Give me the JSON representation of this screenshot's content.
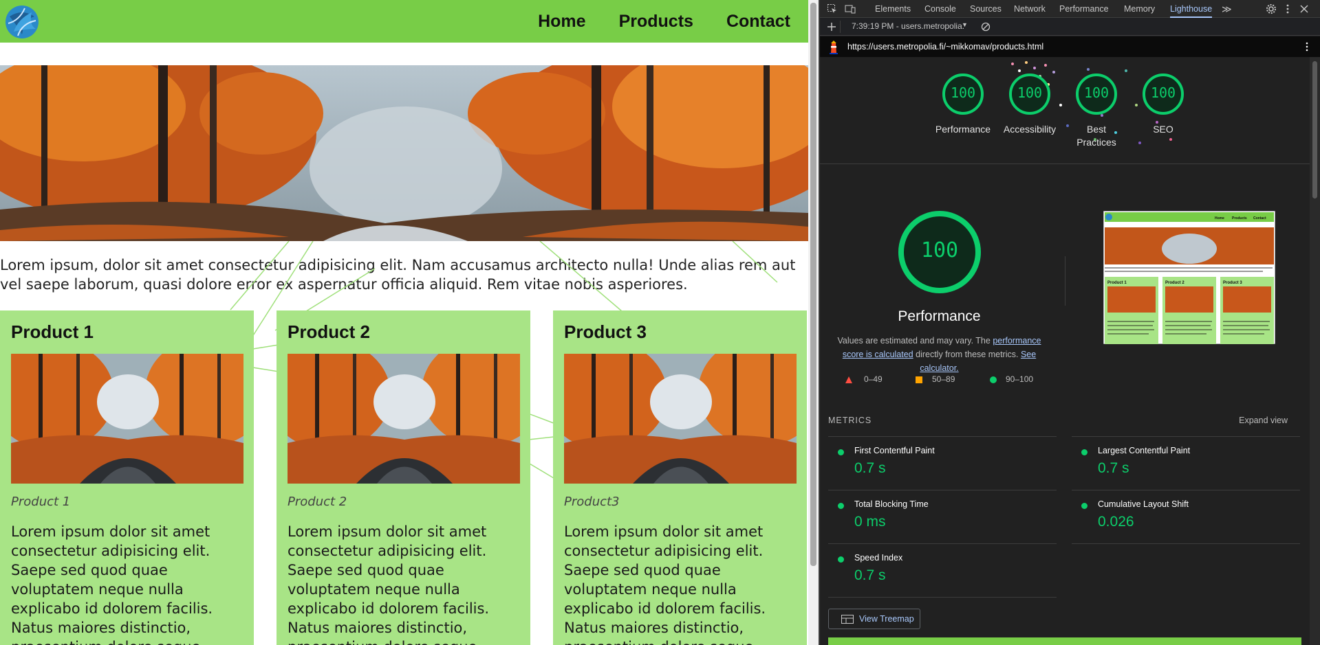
{
  "site": {
    "nav": [
      "Home",
      "Products",
      "Contact"
    ],
    "intro": "Lorem ipsum, dolor sit amet consectetur adipisicing elit. Nam accusamus architecto nulla! Unde alias rem aut vel saepe laborum, quasi dolore error ex aspernatur officia aliquid. Rem vitae nobis asperiores.",
    "products": [
      {
        "title": "Product 1",
        "caption": "Product 1",
        "desc": "Lorem ipsum dolor sit amet consectetur adipisicing elit. Saepe sed quod quae voluptatem neque nulla explicabo id dolorem facilis. Natus maiores distinctio, praesentium dolore seque"
      },
      {
        "title": "Product 2",
        "caption": "Product 2",
        "desc": "Lorem ipsum dolor sit amet consectetur adipisicing elit. Saepe sed quod quae voluptatem neque nulla explicabo id dolorem facilis. Natus maiores distinctio, praesentium dolore seque"
      },
      {
        "title": "Product 3",
        "caption": "Product3",
        "desc": "Lorem ipsum dolor sit amet consectetur adipisicing elit. Saepe sed quod quae voluptatem neque nulla explicabo id dolorem facilis. Natus maiores distinctio, praesentium dolore seque"
      }
    ],
    "colors": {
      "header": "#78cd47",
      "card": "#a8e486"
    }
  },
  "devtools": {
    "tabs": [
      "Elements",
      "Console",
      "Sources",
      "Network",
      "Performance",
      "Memory",
      "Lighthouse"
    ],
    "active_tab": "Lighthouse",
    "more_tabs": "≫",
    "report_time": "7:39:19 PM - users.metropolia.",
    "url": "https://users.metropolia.fi/~mikkomav/products.html",
    "scores": [
      {
        "label": "Performance",
        "value": "100"
      },
      {
        "label": "Accessibility",
        "value": "100"
      },
      {
        "label": "Best Practices",
        "value": "100"
      },
      {
        "label": "SEO",
        "value": "100"
      }
    ],
    "main_score": "100",
    "main_title": "Performance",
    "note_pre": "Values are estimated and may vary. The ",
    "note_link1": "performance score is calculated",
    "note_mid": " directly from these metrics. ",
    "note_link2": "See calculator.",
    "legend": [
      "0–49",
      "50–89",
      "90–100"
    ],
    "metrics_heading": "METRICS",
    "expand_view": "Expand view",
    "metrics": [
      {
        "label": "First Contentful Paint",
        "value": "0.7 s"
      },
      {
        "label": "Largest Contentful Paint",
        "value": "0.7 s"
      },
      {
        "label": "Total Blocking Time",
        "value": "0 ms"
      },
      {
        "label": "Cumulative Layout Shift",
        "value": "0.026"
      },
      {
        "label": "Speed Index",
        "value": "0.7 s"
      }
    ],
    "treemap_button": "View Treemap",
    "thumb_nav": [
      "Home",
      "Products",
      "Contact"
    ],
    "thumb_products": [
      "Product 1",
      "Product 2",
      "Product 3"
    ],
    "colors": {
      "good": "#0cce6b",
      "average": "#ffa400",
      "fail": "#ff4e42",
      "link": "#a8c7fa"
    }
  }
}
